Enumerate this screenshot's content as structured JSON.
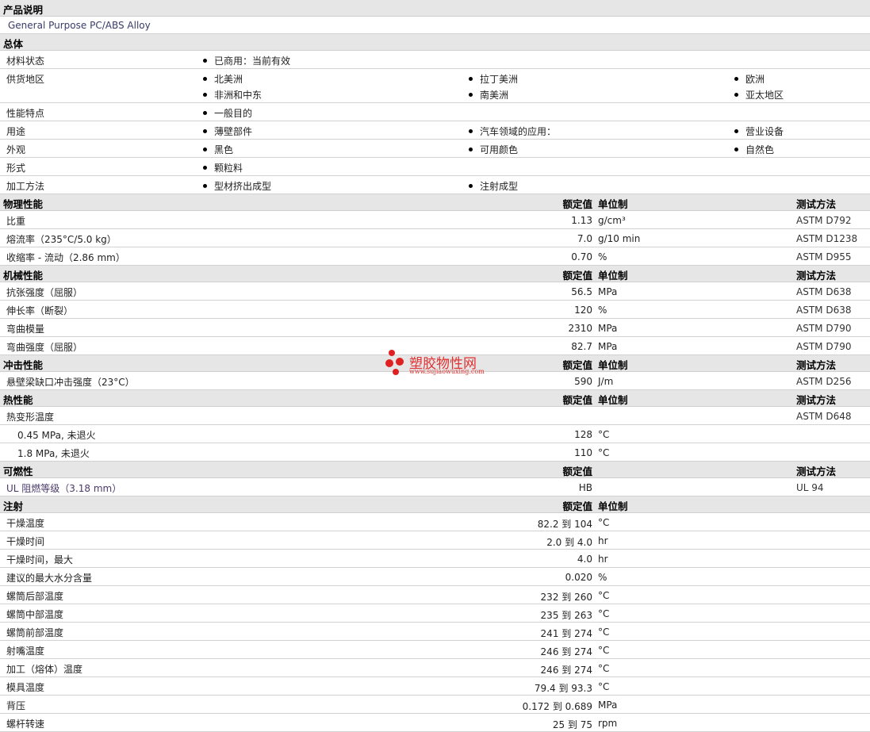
{
  "product_desc": {
    "title": "产品说明",
    "text": "General Purpose PC/ABS Alloy"
  },
  "general": {
    "title": "总体",
    "rows": [
      {
        "label": "材料状态",
        "items": [
          "已商用：当前有效"
        ]
      },
      {
        "label": "供货地区",
        "items": [
          "北美洲",
          "拉丁美洲",
          "欧洲"
        ],
        "items2": [
          "非洲和中东",
          "南美洲",
          "亚太地区"
        ]
      },
      {
        "label": "性能特点",
        "items": [
          "一般目的"
        ]
      },
      {
        "label": "用途",
        "items": [
          "薄壁部件",
          "汽车领域的应用：",
          "营业设备"
        ]
      },
      {
        "label": "外观",
        "items": [
          "黑色",
          "可用颜色",
          "自然色"
        ]
      },
      {
        "label": "形式",
        "items": [
          "颗粒料"
        ]
      },
      {
        "label": "加工方法",
        "items": [
          "型材挤出成型",
          "注射成型"
        ]
      }
    ]
  },
  "col_headers": {
    "nominal": "额定值",
    "unit": "单位制",
    "method": "测试方法"
  },
  "physical": {
    "title": "物理性能",
    "rows": [
      {
        "label": "比重",
        "value": "1.13",
        "unit": "g/cm³",
        "method": "ASTM D792"
      },
      {
        "label": "熔流率（235°C/5.0 kg）",
        "value": "7.0",
        "unit": "g/10 min",
        "method": "ASTM D1238"
      },
      {
        "label": "收缩率  - 流动（2.86 mm）",
        "value": "0.70",
        "unit": "%",
        "method": "ASTM D955"
      }
    ]
  },
  "mechanical": {
    "title": "机械性能",
    "rows": [
      {
        "label": "抗张强度（屈服）",
        "value": "56.5",
        "unit": "MPa",
        "method": "ASTM D638"
      },
      {
        "label": "伸长率（断裂）",
        "value": "120",
        "unit": "%",
        "method": "ASTM D638"
      },
      {
        "label": "弯曲模量",
        "value": "2310",
        "unit": "MPa",
        "method": "ASTM D790"
      },
      {
        "label": "弯曲强度（屈服）",
        "value": "82.7",
        "unit": "MPa",
        "method": "ASTM D790"
      }
    ]
  },
  "impact": {
    "title": "冲击性能",
    "rows": [
      {
        "label": "悬壁梁缺口冲击强度（23°C）",
        "value": "590",
        "unit": "J/m",
        "method": "ASTM D256"
      }
    ]
  },
  "thermal": {
    "title": "热性能",
    "rows": [
      {
        "label": "热变形温度",
        "value": "",
        "unit": "",
        "method": "ASTM D648"
      },
      {
        "label": "0.45 MPa, 未退火",
        "value": "128",
        "unit": "°C",
        "method": ""
      },
      {
        "label": "1.8 MPa, 未退火",
        "value": "110",
        "unit": "°C",
        "method": ""
      }
    ]
  },
  "flammability": {
    "title": "可燃性",
    "rows": [
      {
        "label": "UL 阻燃等级（3.18 mm）",
        "value": "HB",
        "unit": "",
        "method": "UL 94"
      }
    ]
  },
  "injection": {
    "title": "注射",
    "rows": [
      {
        "label": "干燥温度",
        "value": "82.2 到  104",
        "unit": "°C"
      },
      {
        "label": "干燥时间",
        "value": "2.0 到  4.0",
        "unit": "hr"
      },
      {
        "label": "干燥时间，最大",
        "value": "4.0",
        "unit": "hr"
      },
      {
        "label": "建议的最大水分含量",
        "value": "0.020",
        "unit": "%"
      },
      {
        "label": "螺筒后部温度",
        "value": "232 到  260",
        "unit": "°C"
      },
      {
        "label": "螺筒中部温度",
        "value": "235 到  263",
        "unit": "°C"
      },
      {
        "label": "螺筒前部温度",
        "value": "241 到  274",
        "unit": "°C"
      },
      {
        "label": "射嘴温度",
        "value": "246 到  274",
        "unit": "°C"
      },
      {
        "label": "加工（熔体）温度",
        "value": "246 到  274",
        "unit": "°C"
      },
      {
        "label": "模具温度",
        "value": "79.4 到  93.3",
        "unit": "°C"
      },
      {
        "label": "背压",
        "value": "0.172 到  0.689",
        "unit": "MPa"
      },
      {
        "label": "螺杆转速",
        "value": "25 到  75",
        "unit": "rpm"
      }
    ]
  },
  "watermark": {
    "text": "塑胶物性网",
    "url": "www.sujiaowuxing.com"
  }
}
